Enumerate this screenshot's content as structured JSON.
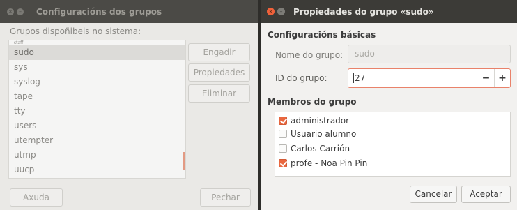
{
  "back_window": {
    "title": "Configuracións dos grupos",
    "list_label": "Grupos dispoñibeis no sistema:",
    "groups": [
      "staff",
      "sudo",
      "sys",
      "syslog",
      "tape",
      "tty",
      "users",
      "utempter",
      "utmp",
      "uucp"
    ],
    "selected_group": "sudo",
    "buttons": {
      "add": "Engadir",
      "properties": "Propiedades",
      "delete": "Eliminar",
      "help": "Axuda",
      "close": "Pechar"
    }
  },
  "dialog": {
    "title": "Propiedades do grupo «sudo»",
    "basic_section": "Configuracións básicas",
    "name_label": "Nome do grupo:",
    "name_value": "sudo",
    "id_label": "ID do grupo:",
    "id_value": "27",
    "spin_minus": "−",
    "spin_plus": "+",
    "members_section": "Membros do grupo",
    "members": [
      {
        "name": "administrador",
        "checked": true
      },
      {
        "name": "Usuario alumno",
        "checked": false
      },
      {
        "name": "Carlos Carrión",
        "checked": false
      },
      {
        "name": "profe - Noa Pin Pin",
        "checked": true
      }
    ],
    "cancel_label": "Cancelar",
    "accept_label": "Aceptar"
  },
  "icons": {
    "close": "close-icon",
    "minimize": "minimize-icon",
    "checkbox_checked": "checkmark-icon"
  },
  "colors": {
    "accent": "#e9673f",
    "titlebar": "#3c3b37"
  }
}
